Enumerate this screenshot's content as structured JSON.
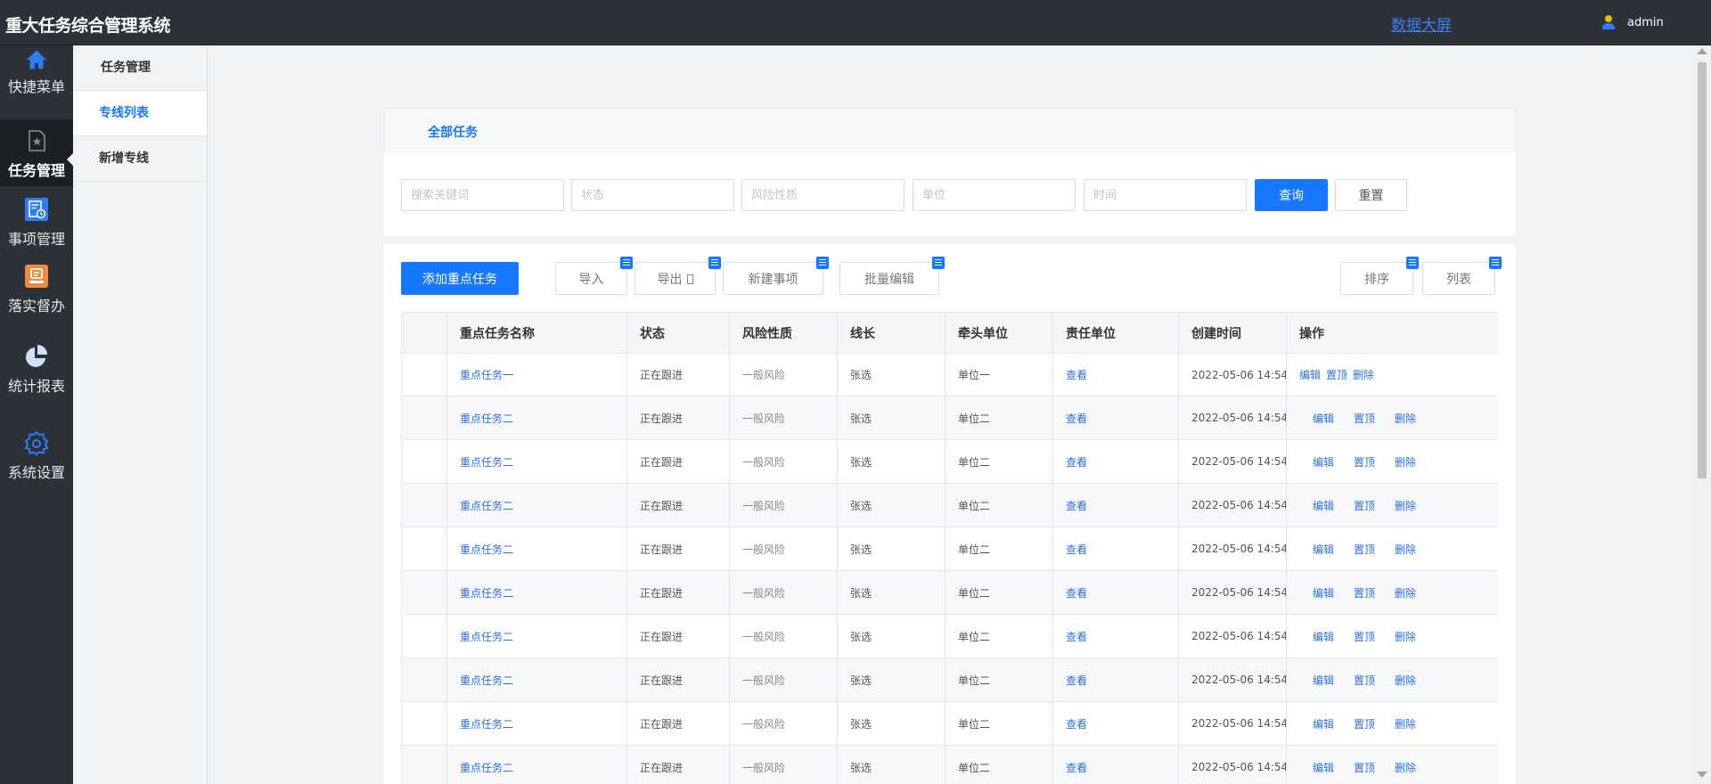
{
  "header": {
    "app_title": "重大任务综合管理系统",
    "bigscreen_link": "数据大屏",
    "user_name": "admin"
  },
  "nav": [
    {
      "label": "快捷菜单",
      "icon": "home-icon",
      "active": false
    },
    {
      "label": "任务管理",
      "icon": "task-document-icon",
      "active": true
    },
    {
      "label": "事项管理",
      "icon": "item-list-icon",
      "active": false
    },
    {
      "label": "落实督办",
      "icon": "supervise-icon",
      "active": false
    },
    {
      "label": "统计报表",
      "icon": "pie-chart-icon",
      "active": false
    },
    {
      "label": "系统设置",
      "icon": "gear-icon",
      "active": false
    }
  ],
  "submenu": {
    "title": "任务管理",
    "items": [
      "专线列表",
      "新增专线"
    ],
    "active": "专线列表"
  },
  "tabs": {
    "all": "全部任务"
  },
  "filters": {
    "keyword_placeholder": "搜索关键词",
    "status_placeholder": "状态",
    "risk_placeholder": "风险性质",
    "unit_placeholder": "单位",
    "time_placeholder": "时间",
    "query": "查询",
    "reset": "重置"
  },
  "toolbar": {
    "add": "添加重点任务",
    "import": "导入",
    "export": "导出",
    "new_item": "新建事项",
    "batch_edit": "批量编辑",
    "sort": "排序",
    "list": "列表"
  },
  "table": {
    "columns": [
      "",
      "重点任务名称",
      "状态",
      "风险性质",
      "线长",
      "牵头单位",
      "责任单位",
      "创建时间",
      "操作"
    ],
    "view_label": "查看",
    "ops": [
      "编辑",
      "置顶",
      "删除"
    ],
    "rows": [
      {
        "name": "重点任务一",
        "status": "正在跟进",
        "risk": "一般风险",
        "leader": "张选",
        "lead_unit": "单位一",
        "created": "2022-05-06 14:54"
      },
      {
        "name": "重点任务二",
        "status": "正在跟进",
        "risk": "一般风险",
        "leader": "张选",
        "lead_unit": "单位二",
        "created": "2022-05-06 14:54"
      },
      {
        "name": "重点任务二",
        "status": "正在跟进",
        "risk": "一般风险",
        "leader": "张选",
        "lead_unit": "单位二",
        "created": "2022-05-06 14:54"
      },
      {
        "name": "重点任务二",
        "status": "正在跟进",
        "risk": "一般风险",
        "leader": "张选",
        "lead_unit": "单位二",
        "created": "2022-05-06 14:54"
      },
      {
        "name": "重点任务二",
        "status": "正在跟进",
        "risk": "一般风险",
        "leader": "张选",
        "lead_unit": "单位二",
        "created": "2022-05-06 14:54"
      },
      {
        "name": "重点任务二",
        "status": "正在跟进",
        "risk": "一般风险",
        "leader": "张选",
        "lead_unit": "单位二",
        "created": "2022-05-06 14:54"
      },
      {
        "name": "重点任务二",
        "status": "正在跟进",
        "risk": "一般风险",
        "leader": "张选",
        "lead_unit": "单位二",
        "created": "2022-05-06 14:54"
      },
      {
        "name": "重点任务二",
        "status": "正在跟进",
        "risk": "一般风险",
        "leader": "张选",
        "lead_unit": "单位二",
        "created": "2022-05-06 14:54"
      },
      {
        "name": "重点任务二",
        "status": "正在跟进",
        "risk": "一般风险",
        "leader": "张选",
        "lead_unit": "单位二",
        "created": "2022-05-06 14:54"
      },
      {
        "name": "重点任务二",
        "status": "正在跟进",
        "risk": "一般风险",
        "leader": "张选",
        "lead_unit": "单位二",
        "created": "2022-05-06 14:54"
      }
    ]
  },
  "colors": {
    "primary": "#1677ff",
    "sidebar_bg": "#2d3238",
    "link": "#2b6fe5",
    "main_bg": "#f2f3f5"
  }
}
